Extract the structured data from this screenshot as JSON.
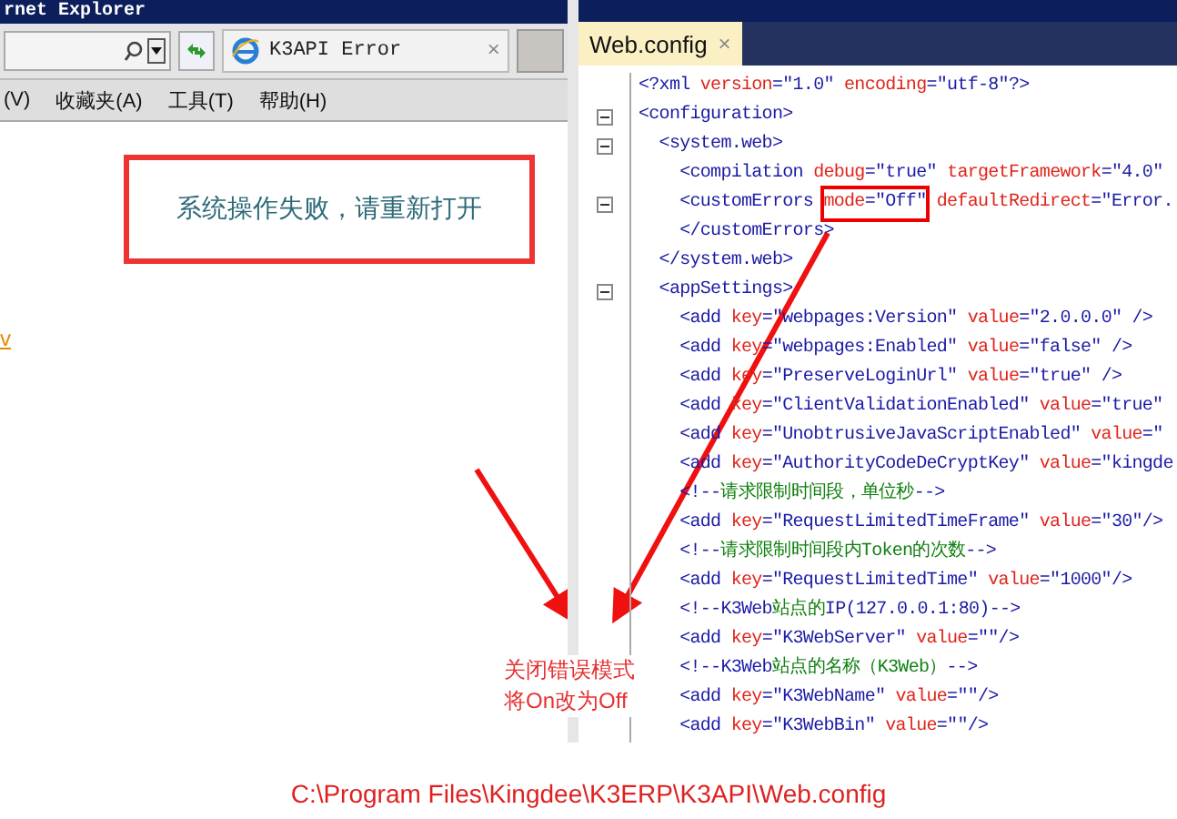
{
  "browser": {
    "title": "rnet Explorer",
    "tab": {
      "label": "K3API Error",
      "selected": true,
      "close": "×"
    },
    "menu": [
      "(V)",
      "收藏夹(A)",
      "工具(T)",
      "帮助(H)"
    ],
    "link_fragment": "v"
  },
  "error_box": {
    "message": "系统操作失败，请重新打开"
  },
  "editor": {
    "tab": {
      "label": "Web.config",
      "selected": true,
      "close": "×"
    },
    "lines": [
      {
        "fold": false,
        "segments": [
          {
            "kind": "tag",
            "text": "<?xml "
          },
          {
            "kind": "attr",
            "text": "version"
          },
          {
            "kind": "tag",
            "text": "=\"1.0\" "
          },
          {
            "kind": "attr",
            "text": "encoding"
          },
          {
            "kind": "tag",
            "text": "=\"utf-8\"?>"
          }
        ]
      },
      {
        "fold": true,
        "segments": [
          {
            "kind": "tag",
            "text": "<configuration>"
          }
        ]
      },
      {
        "fold": true,
        "segments": [
          {
            "kind": "tag",
            "text": "  <system.web>"
          }
        ]
      },
      {
        "fold": false,
        "segments": [
          {
            "kind": "tag",
            "text": "    <compilation "
          },
          {
            "kind": "attr",
            "text": "debug"
          },
          {
            "kind": "tag",
            "text": "=\"true\" "
          },
          {
            "kind": "attr",
            "text": "targetFramework"
          },
          {
            "kind": "tag",
            "text": "=\"4.0\""
          }
        ]
      },
      {
        "fold": true,
        "segments": [
          {
            "kind": "tag",
            "text": "    <customErrors "
          },
          {
            "kind": "attr",
            "text": "mode",
            "highlighted": true
          },
          {
            "kind": "tag",
            "text": "=\"Off\"",
            "highlighted": true
          },
          {
            "kind": "attr",
            "text": " defaultRedirect"
          },
          {
            "kind": "tag",
            "text": "=\"Error."
          }
        ]
      },
      {
        "fold": false,
        "segments": [
          {
            "kind": "tag",
            "text": "    </customErrors>"
          }
        ]
      },
      {
        "fold": false,
        "segments": [
          {
            "kind": "tag",
            "text": "  </system.web>"
          }
        ]
      },
      {
        "fold": true,
        "segments": [
          {
            "kind": "tag",
            "text": "  <appSettings>"
          }
        ]
      },
      {
        "fold": false,
        "segments": [
          {
            "kind": "tag",
            "text": "    <add "
          },
          {
            "kind": "attr",
            "text": "key"
          },
          {
            "kind": "tag",
            "text": "=\"webpages:Version\" "
          },
          {
            "kind": "attr",
            "text": "value"
          },
          {
            "kind": "tag",
            "text": "=\"2.0.0.0\" />"
          }
        ]
      },
      {
        "fold": false,
        "segments": [
          {
            "kind": "tag",
            "text": "    <add "
          },
          {
            "kind": "attr",
            "text": "key"
          },
          {
            "kind": "tag",
            "text": "=\"webpages:Enabled\" "
          },
          {
            "kind": "attr",
            "text": "value"
          },
          {
            "kind": "tag",
            "text": "=\"false\" />"
          }
        ]
      },
      {
        "fold": false,
        "segments": [
          {
            "kind": "tag",
            "text": "    <add "
          },
          {
            "kind": "attr",
            "text": "key"
          },
          {
            "kind": "tag",
            "text": "=\"PreserveLoginUrl\" "
          },
          {
            "kind": "attr",
            "text": "value"
          },
          {
            "kind": "tag",
            "text": "=\"true\" />"
          }
        ]
      },
      {
        "fold": false,
        "segments": [
          {
            "kind": "tag",
            "text": "    <add "
          },
          {
            "kind": "attr",
            "text": "key"
          },
          {
            "kind": "tag",
            "text": "=\"ClientValidationEnabled\" "
          },
          {
            "kind": "attr",
            "text": "value"
          },
          {
            "kind": "tag",
            "text": "=\"true\""
          }
        ]
      },
      {
        "fold": false,
        "segments": [
          {
            "kind": "tag",
            "text": "    <add "
          },
          {
            "kind": "attr",
            "text": "key"
          },
          {
            "kind": "tag",
            "text": "=\"UnobtrusiveJavaScriptEnabled\" "
          },
          {
            "kind": "attr",
            "text": "value"
          },
          {
            "kind": "tag",
            "text": "=\""
          }
        ]
      },
      {
        "fold": false,
        "segments": [
          {
            "kind": "tag",
            "text": "    <add "
          },
          {
            "kind": "attr",
            "text": "key"
          },
          {
            "kind": "tag",
            "text": "=\"AuthorityCodeDeCryptKey\" "
          },
          {
            "kind": "attr",
            "text": "value"
          },
          {
            "kind": "tag",
            "text": "=\"kingde"
          }
        ]
      },
      {
        "fold": false,
        "segments": [
          {
            "kind": "tag",
            "text": "    <!--"
          },
          {
            "kind": "comment",
            "text": "请求限制时间段，单位秒"
          },
          {
            "kind": "tag",
            "text": "-->"
          }
        ]
      },
      {
        "fold": false,
        "segments": [
          {
            "kind": "tag",
            "text": "    <add "
          },
          {
            "kind": "attr",
            "text": "key"
          },
          {
            "kind": "tag",
            "text": "=\"RequestLimitedTimeFrame\" "
          },
          {
            "kind": "attr",
            "text": "value"
          },
          {
            "kind": "tag",
            "text": "=\"30\"/>"
          }
        ]
      },
      {
        "fold": false,
        "segments": [
          {
            "kind": "tag",
            "text": "    <!--"
          },
          {
            "kind": "comment",
            "text": "请求限制时间段内Token的次数"
          },
          {
            "kind": "tag",
            "text": "-->"
          }
        ]
      },
      {
        "fold": false,
        "segments": [
          {
            "kind": "tag",
            "text": "    <add "
          },
          {
            "kind": "attr",
            "text": "key"
          },
          {
            "kind": "tag",
            "text": "=\"RequestLimitedTime\" "
          },
          {
            "kind": "attr",
            "text": "value"
          },
          {
            "kind": "tag",
            "text": "=\"1000\"/>"
          }
        ]
      },
      {
        "fold": false,
        "segments": [
          {
            "kind": "tag",
            "text": "    <!--K3Web"
          },
          {
            "kind": "comment",
            "text": "站点的"
          },
          {
            "kind": "tag",
            "text": "IP(127.0.0.1:80)-->"
          }
        ]
      },
      {
        "fold": false,
        "segments": [
          {
            "kind": "tag",
            "text": "    <add "
          },
          {
            "kind": "attr",
            "text": "key"
          },
          {
            "kind": "tag",
            "text": "=\"K3WebServer\" "
          },
          {
            "kind": "attr",
            "text": "value"
          },
          {
            "kind": "tag",
            "text": "=\"\"/>"
          }
        ]
      },
      {
        "fold": false,
        "segments": [
          {
            "kind": "tag",
            "text": "    <!--K3Web"
          },
          {
            "kind": "comment",
            "text": "站点的名称（K3Web）"
          },
          {
            "kind": "tag",
            "text": "-->"
          }
        ]
      },
      {
        "fold": false,
        "segments": [
          {
            "kind": "tag",
            "text": "    <add "
          },
          {
            "kind": "attr",
            "text": "key"
          },
          {
            "kind": "tag",
            "text": "=\"K3WebName\" "
          },
          {
            "kind": "attr",
            "text": "value"
          },
          {
            "kind": "tag",
            "text": "=\"\"/>"
          }
        ]
      },
      {
        "fold": false,
        "segments": [
          {
            "kind": "tag",
            "text": "    <add "
          },
          {
            "kind": "attr",
            "text": "key"
          },
          {
            "kind": "tag",
            "text": "=\"K3WebBin\" "
          },
          {
            "kind": "attr",
            "text": "value"
          },
          {
            "kind": "tag",
            "text": "=\"\"/>"
          }
        ]
      }
    ]
  },
  "annotation": [
    "关闭错误模式",
    "将On改为Off"
  ],
  "caption": "C:\\Program Files\\Kingdee\\K3ERP\\K3API\\Web.config"
}
